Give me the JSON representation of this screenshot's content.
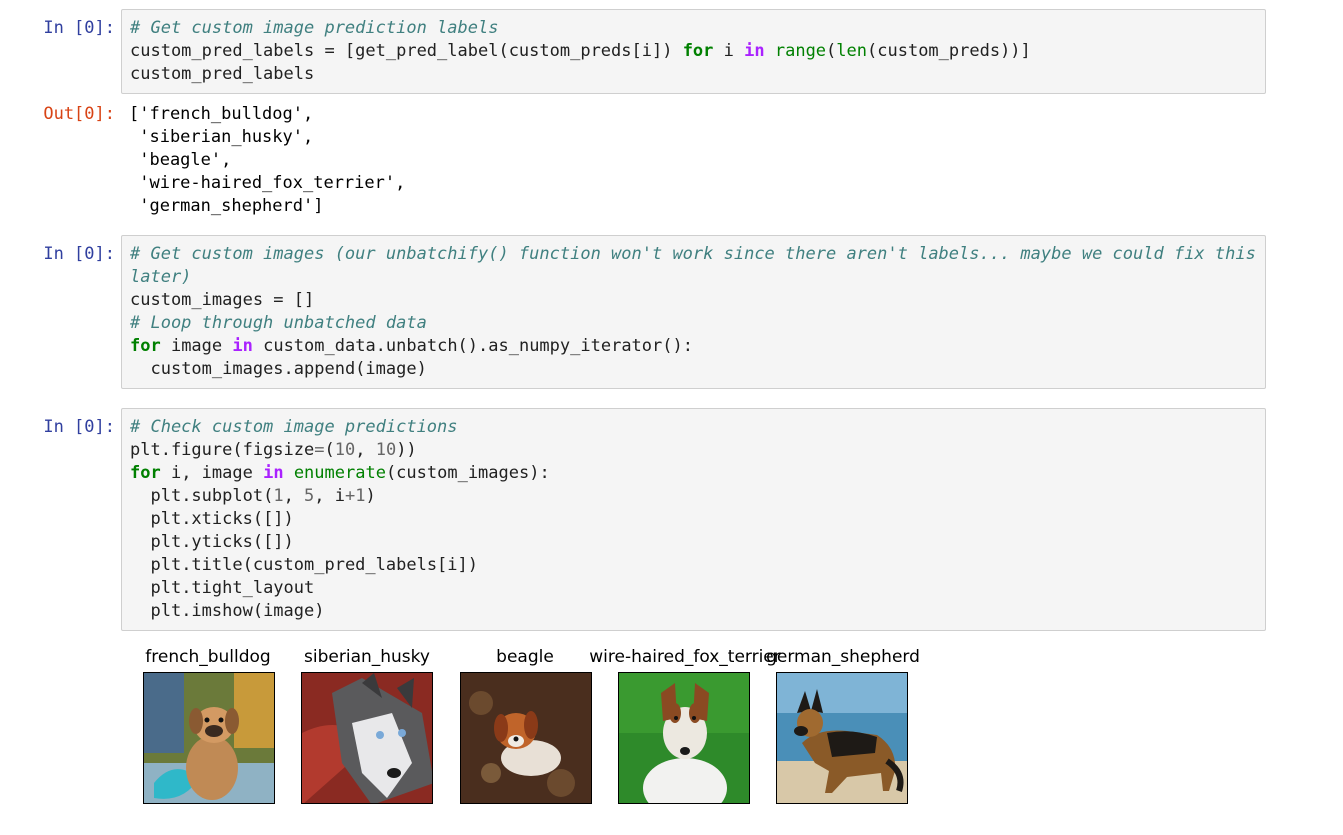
{
  "cells": [
    {
      "prompt": "In [0]:",
      "lines": [
        [
          [
            "cm",
            "# Get custom image prediction labels"
          ]
        ],
        [
          [
            "t",
            "custom_pred_labels = [get_pred_label(custom_preds[i]) "
          ],
          [
            "kw",
            "for"
          ],
          [
            "t",
            " i "
          ],
          [
            "ow",
            "in"
          ],
          [
            "t",
            " "
          ],
          [
            "bi",
            "range"
          ],
          [
            "t",
            "("
          ],
          [
            "bi",
            "len"
          ],
          [
            "t",
            "(custom_preds))]"
          ]
        ],
        [
          [
            "t",
            "custom_pred_labels"
          ]
        ]
      ]
    },
    {
      "prompt": "In [0]:",
      "lines": [
        [
          [
            "cm",
            "# Get custom images (our unbatchify() function won't work since there aren't labels... maybe we could fix this later)"
          ]
        ],
        [
          [
            "t",
            "custom_images = []"
          ]
        ],
        [
          [
            "cm",
            "# Loop through unbatched data"
          ]
        ],
        [
          [
            "kw",
            "for"
          ],
          [
            "t",
            " image "
          ],
          [
            "ow",
            "in"
          ],
          [
            "t",
            " custom_data.unbatch().as_numpy_iterator():"
          ]
        ],
        [
          [
            "t",
            "  custom_images.append(image)"
          ]
        ]
      ]
    },
    {
      "prompt": "In [0]:",
      "lines": [
        [
          [
            "cm",
            "# Check custom image predictions"
          ]
        ],
        [
          [
            "t",
            "plt.figure(figsize"
          ],
          [
            "op",
            "="
          ],
          [
            "t",
            "("
          ],
          [
            "nm",
            "10"
          ],
          [
            "t",
            ", "
          ],
          [
            "nm",
            "10"
          ],
          [
            "t",
            "))"
          ]
        ],
        [
          [
            "kw",
            "for"
          ],
          [
            "t",
            " i, image "
          ],
          [
            "ow",
            "in"
          ],
          [
            "t",
            " "
          ],
          [
            "bi",
            "enumerate"
          ],
          [
            "t",
            "(custom_images):"
          ]
        ],
        [
          [
            "t",
            "  plt.subplot("
          ],
          [
            "nm",
            "1"
          ],
          [
            "t",
            ", "
          ],
          [
            "nm",
            "5"
          ],
          [
            "t",
            ", i"
          ],
          [
            "op",
            "+"
          ],
          [
            "nm",
            "1"
          ],
          [
            "t",
            ")"
          ]
        ],
        [
          [
            "t",
            "  plt.xticks([])"
          ]
        ],
        [
          [
            "t",
            "  plt.yticks([])"
          ]
        ],
        [
          [
            "t",
            "  plt.title(custom_pred_labels[i])"
          ]
        ],
        [
          [
            "t",
            "  plt.tight_layout"
          ]
        ],
        [
          [
            "t",
            "  plt.imshow(image)"
          ]
        ]
      ]
    }
  ],
  "output": {
    "prompt": "Out[0]:",
    "text": "['french_bulldog',\n 'siberian_husky',\n 'beagle',\n 'wire-haired_fox_terrier',\n 'german_shepherd']"
  },
  "figure": {
    "subplots": [
      {
        "title": "french_bulldog",
        "image": "dog-photo"
      },
      {
        "title": "siberian_husky",
        "image": "dog-photo"
      },
      {
        "title": "beagle",
        "image": "dog-photo"
      },
      {
        "title": "wire-haired_fox_terrier",
        "image": "dog-photo"
      },
      {
        "title": "german_shepherd",
        "image": "dog-photo"
      }
    ]
  }
}
